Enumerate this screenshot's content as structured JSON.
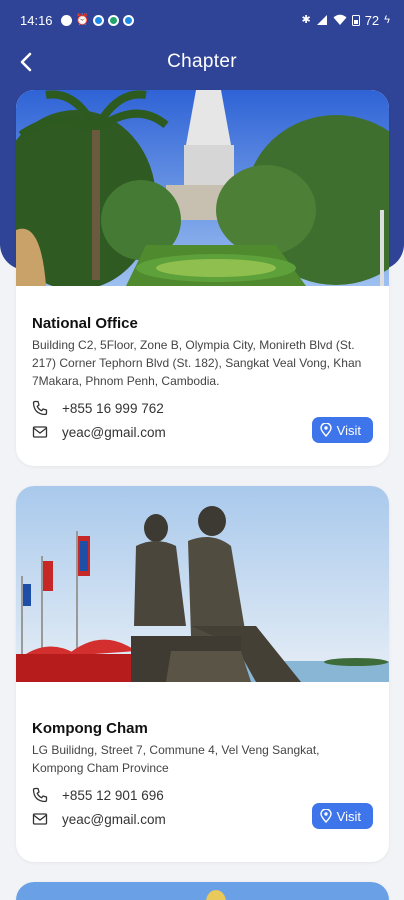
{
  "status_bar": {
    "time": "14:16",
    "battery": "72"
  },
  "app_bar": {
    "title": "Chapter"
  },
  "offices": [
    {
      "name": "National Office",
      "address": "Building C2, 5Floor, Zone B, Olympia City, Monireth Blvd (St. 217) Corner Tephorn Blvd (St. 182), Sangkat Veal Vong, Khan 7Makara, Phnom Penh, Cambodia.",
      "phone": "+855 16 999 762",
      "email": "yeac@gmail.com",
      "visit_label": "Visit"
    },
    {
      "name": "Kompong Cham",
      "address": "LG Builidng, Street 7, Commune 4, Vel Veng Sangkat, Kompong Cham Province",
      "phone": "+855 12 901 696",
      "email": "yeac@gmail.com",
      "visit_label": "Visit"
    }
  ],
  "colors": {
    "header": "#2f4496",
    "accent": "#3f75ea",
    "background": "#f2f3f6"
  }
}
